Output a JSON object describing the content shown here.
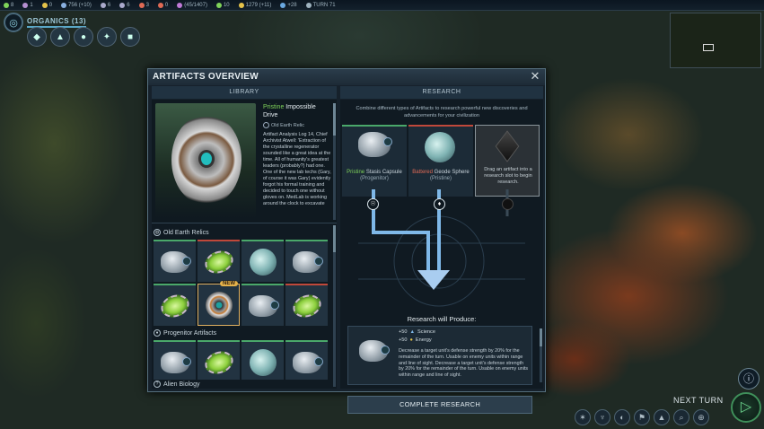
{
  "topbar": {
    "items": [
      {
        "icon": "science-icon",
        "value": "8",
        "color": "#7fd35a"
      },
      {
        "icon": "culture-icon",
        "value": "1",
        "color": "#b58fd0"
      },
      {
        "icon": "energy-icon",
        "value": "0",
        "color": "#e6c34a"
      },
      {
        "icon": "faith-icon",
        "value": "756 (+10)",
        "color": "#8ab0e0"
      },
      {
        "icon": "resource-icon",
        "value": "6",
        "color": "#aac"
      },
      {
        "icon": "resource-icon-2",
        "value": "6",
        "color": "#aac"
      },
      {
        "icon": "resource-icon-3",
        "value": "3",
        "color": "#e06a55"
      },
      {
        "icon": "resource-icon-4",
        "value": "0",
        "color": "#e06a55"
      },
      {
        "icon": "culture-total-icon",
        "value": "(45/1407)",
        "color": "#c07ad8"
      },
      {
        "icon": "health-icon",
        "value": "10",
        "color": "#7fd35a"
      },
      {
        "icon": "energy-total-icon",
        "value": "1279 (+11)",
        "color": "#e6c34a"
      },
      {
        "icon": "research-icon",
        "value": "+28",
        "color": "#6aa8e0"
      },
      {
        "icon": "turn-icon",
        "value": "TURN 71",
        "color": "#9fb3bf"
      }
    ]
  },
  "organics": {
    "title": "ORGANICS (13)"
  },
  "dialog": {
    "title": "ARTIFACTS OVERVIEW",
    "library_header": "LIBRARY",
    "research_header": "RESEARCH"
  },
  "featured": {
    "quality": "Pristine",
    "name": "Impossible Drive",
    "category": "Old Earth Relic",
    "description": "Artifact Analysis Log 14, Chief Archivist Atwell: 'Extraction of the crystalline regenerator sounded like a great idea at the time. All of humanity's greatest leaders (probably?) had one. One of the new lab techs (Gary, of course it was Gary) evidently forgot his formal training and decided to touch one without gloves on. MedLab is working around the clock to excavate"
  },
  "sections": [
    {
      "name": "Old Earth Relics",
      "icon": "globe-icon"
    },
    {
      "name": "Progenitor Artifacts",
      "icon": "flame-icon"
    },
    {
      "name": "Alien Biology",
      "icon": "question-icon"
    }
  ],
  "new_badge": "NEW",
  "research": {
    "intro": "Combine different types of Artifacts to research powerful new discoveries and advancements for your civilization",
    "slots": [
      {
        "quality": "Pristine",
        "name": "Stasis Capsule",
        "origin": "(Progenitor)"
      },
      {
        "quality": "Battered",
        "name": "Geode Sphere",
        "origin": "(Pristine)"
      },
      {
        "text": "Drag an artifact into a research slot to begin research."
      }
    ],
    "will_produce": "Research will Produce:",
    "bonus1": "+50",
    "bonus1_label": "Science",
    "bonus2": "+50",
    "bonus2_label": "Energy",
    "effect": "Decrease a target unit's defense strength by 20% for the remainder of the turn. Usable on enemy units within range and line of sight. Decrease a target unit's defense strength by 20% for the remainder of the turn. Usable on enemy units within range and line of sight.",
    "complete": "COMPLETE RESEARCH"
  },
  "footer": {
    "next_turn": "NEXT TURN"
  },
  "colors": {
    "pristine": "#7fd35a",
    "battered": "#e06a55",
    "accent": "#4aa86a"
  }
}
